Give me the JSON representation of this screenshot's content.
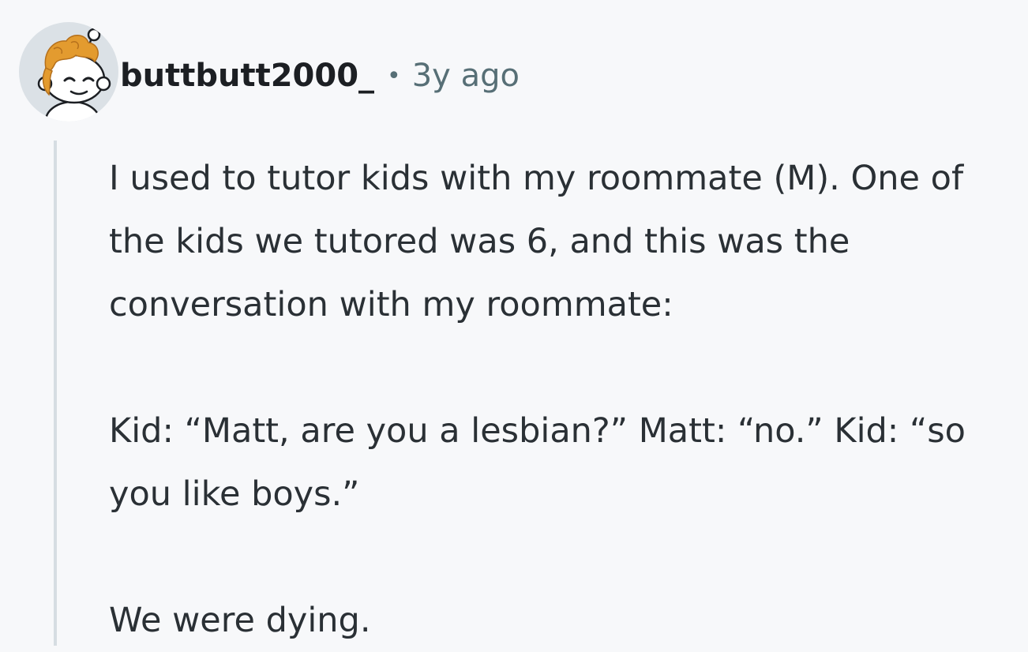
{
  "comment": {
    "username": "buttbutt2000_",
    "separator": "•",
    "timestamp": "3y ago",
    "avatar_icon": "snoo-avatar-icon",
    "paragraphs": [
      "I used to tutor kids with my roommate (M). One of the kids we tutored was 6, and this was the conversation with my roommate:",
      "Kid: “Matt, are you a lesbian?” Matt: “no.” Kid: “so you like boys.”",
      "We were dying."
    ]
  },
  "colors": {
    "background": "#f7f8fa",
    "username": "#1c1f23",
    "meta": "#576f76",
    "thread_line": "#d6dde2",
    "avatar_bg": "#dbe1e6",
    "hair": "#e39b2f"
  }
}
